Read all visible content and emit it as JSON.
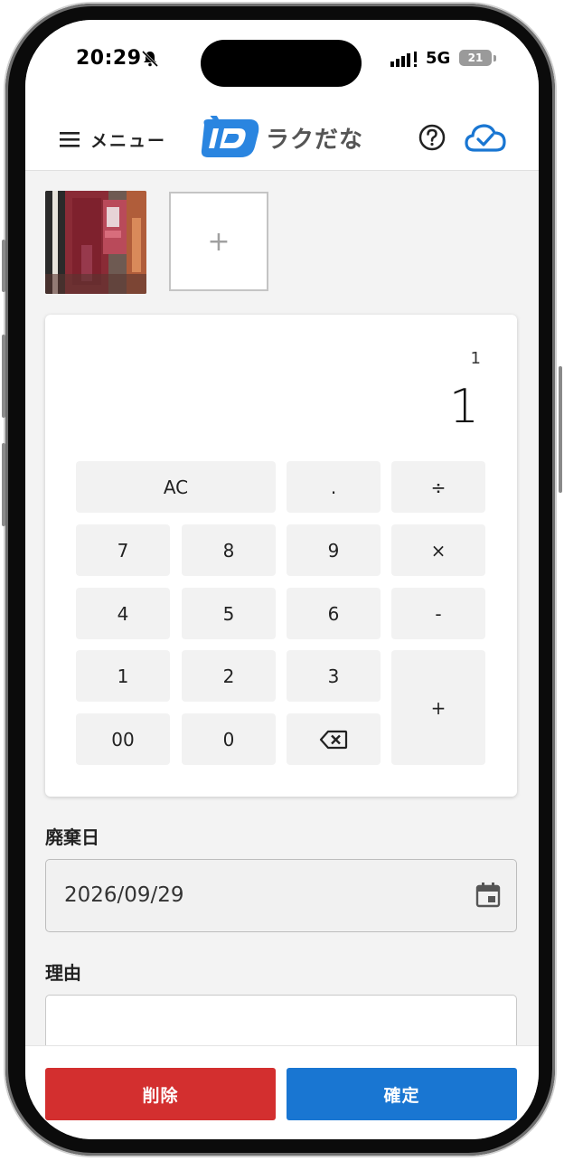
{
  "status_bar": {
    "time": "20:29",
    "network": "5G",
    "battery": "21"
  },
  "app_bar": {
    "menu_label": "メニュー",
    "app_name": "ラクだな"
  },
  "photos": {
    "add_label": "+"
  },
  "calculator": {
    "expression": "1",
    "result": "1",
    "keys": {
      "ac": "AC",
      "dot": ".",
      "divide": "÷",
      "multiply": "×",
      "minus": "-",
      "plus": "+",
      "n7": "7",
      "n8": "8",
      "n9": "9",
      "n4": "4",
      "n5": "5",
      "n6": "6",
      "n1": "1",
      "n2": "2",
      "n3": "3",
      "n00": "00",
      "n0": "0"
    }
  },
  "form": {
    "disposal_date_label": "廃棄日",
    "disposal_date_value": "2026/09/29",
    "reason_label": "理由",
    "reason_value": ""
  },
  "actions": {
    "delete_label": "削除",
    "confirm_label": "確定"
  },
  "colors": {
    "accent": "#1976d2",
    "danger": "#d32f2f",
    "logo_blue": "#2a85e0"
  },
  "icons": [
    "bell-slash-icon",
    "signal-icon",
    "battery-icon",
    "hamburger-icon",
    "logo-icon",
    "help-icon",
    "cloud-check-icon",
    "backspace-icon",
    "calendar-icon"
  ]
}
